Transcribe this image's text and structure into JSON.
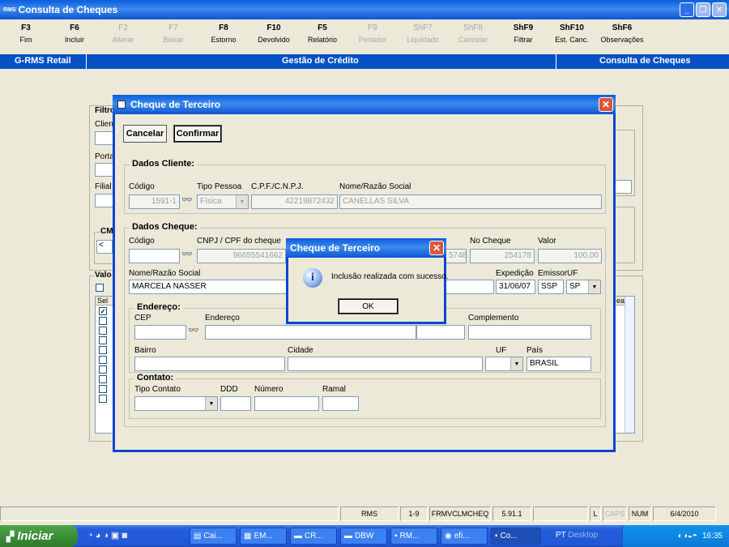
{
  "window": {
    "title": "Consulta de Cheques",
    "app_icon": "RMS"
  },
  "fkeys": [
    {
      "key": "F3",
      "label": "Fim",
      "enabled": true
    },
    {
      "key": "F6",
      "label": "Incluir",
      "enabled": true
    },
    {
      "key": "F2",
      "label": "Alterar",
      "enabled": false
    },
    {
      "key": "F7",
      "label": "Baixar",
      "enabled": false
    },
    {
      "key": "F8",
      "label": "Estorno",
      "enabled": true
    },
    {
      "key": "F10",
      "label": "Devolvido",
      "enabled": true
    },
    {
      "key": "F5",
      "label": "Relatório",
      "enabled": true
    },
    {
      "key": "F9",
      "label": "Portador",
      "enabled": false
    },
    {
      "key": "ShF7",
      "label": "Liquidado",
      "enabled": false
    },
    {
      "key": "ShF8",
      "label": "Cancelar",
      "enabled": false
    },
    {
      "key": "ShF9",
      "label": "Filtrar",
      "enabled": true
    },
    {
      "key": "ShF10",
      "label": "Est. Canc.",
      "enabled": true
    },
    {
      "key": "ShF6",
      "label": "Observações",
      "enabled": true
    }
  ],
  "bluebar": {
    "left": "G-RMS Retail",
    "center": "Gestão de Crédito",
    "right": "Consulta de Cheques"
  },
  "background_form": {
    "filter_title": "Filtro",
    "cliente": "Client",
    "portador": "Porta",
    "filial": "Filial",
    "cm": "CM",
    "cm_value": "<",
    "valores": "Valo",
    "grid_sel": "Sel",
    "grid_col_right": "ea"
  },
  "dialog": {
    "title": "Cheque de Terceiro",
    "cancel_label": "Cancelar",
    "confirm_label": "Confirmar",
    "dados_cliente": {
      "title": "Dados Cliente:",
      "codigo_label": "Código",
      "codigo_value": "1591-1",
      "tipo_pessoa_label": "Tipo Pessoa",
      "tipo_pessoa_value": "Física",
      "cpf_label": "C.P.F./C.N.P.J.",
      "cpf_value": "42219872432",
      "nome_label": "Nome/Razão Social",
      "nome_value": "CANELLAS SILVA"
    },
    "dados_cheque": {
      "title": "Dados Cheque:",
      "codigo_label": "Código",
      "codigo_value": "",
      "cnpj_label": "CNPJ / CPF do cheque",
      "cnpj_value": "96655541662",
      "conta_partial": "5748",
      "no_cheque_label": "No Cheque",
      "no_cheque_value": "254178",
      "valor_label": "Valor",
      "valor_value": "100,00",
      "nome_label": "Nome/Razão Social",
      "nome_value": "MARCELA NASSER",
      "expedicao_label": "Expedição",
      "expedicao_value": "31/06/07",
      "emissor_label": "Emissor",
      "emissor_value": "SSP",
      "uf_label": "UF",
      "uf_value": "SP"
    },
    "endereco": {
      "title": "Endereço:",
      "cep_label": "CEP",
      "endereco_label": "Endereço",
      "complemento_label": "Complemento",
      "bairro_label": "Bairro",
      "cidade_label": "Cidade",
      "uf_label": "UF",
      "pais_label": "País",
      "pais_value": "BRASIL"
    },
    "contato": {
      "title": "Contato:",
      "tipo_label": "Tipo Contato",
      "ddd_label": "DDD",
      "numero_label": "Número",
      "ramal_label": "Ramal"
    }
  },
  "message_box": {
    "title": "Cheque de Terceiro",
    "icon": "info-icon",
    "text": "Inclusão realizada com sucesso.",
    "ok_label": "OK"
  },
  "statusbar": {
    "app": "RMS",
    "range": "1-9",
    "form": "FRMVCLMCHEQ",
    "version": "5.91.1",
    "l": "L",
    "caps": "CAPS",
    "num": "NUM",
    "date": "6/4/2010"
  },
  "taskbar": {
    "start_label": "Iniciar",
    "tasks": [
      "Cai...",
      "EM...",
      "CR...",
      "DBW",
      "RM...",
      "efi...",
      "Co..."
    ],
    "lang": "PT",
    "desktop": "Desktop",
    "clock": "16:35"
  },
  "colors": {
    "titlebar": "#0A5EDB",
    "bluebar": "#0651C6",
    "face": "#ECE9D8",
    "taskbar": "#245EDB",
    "start": "#3C8E37"
  }
}
